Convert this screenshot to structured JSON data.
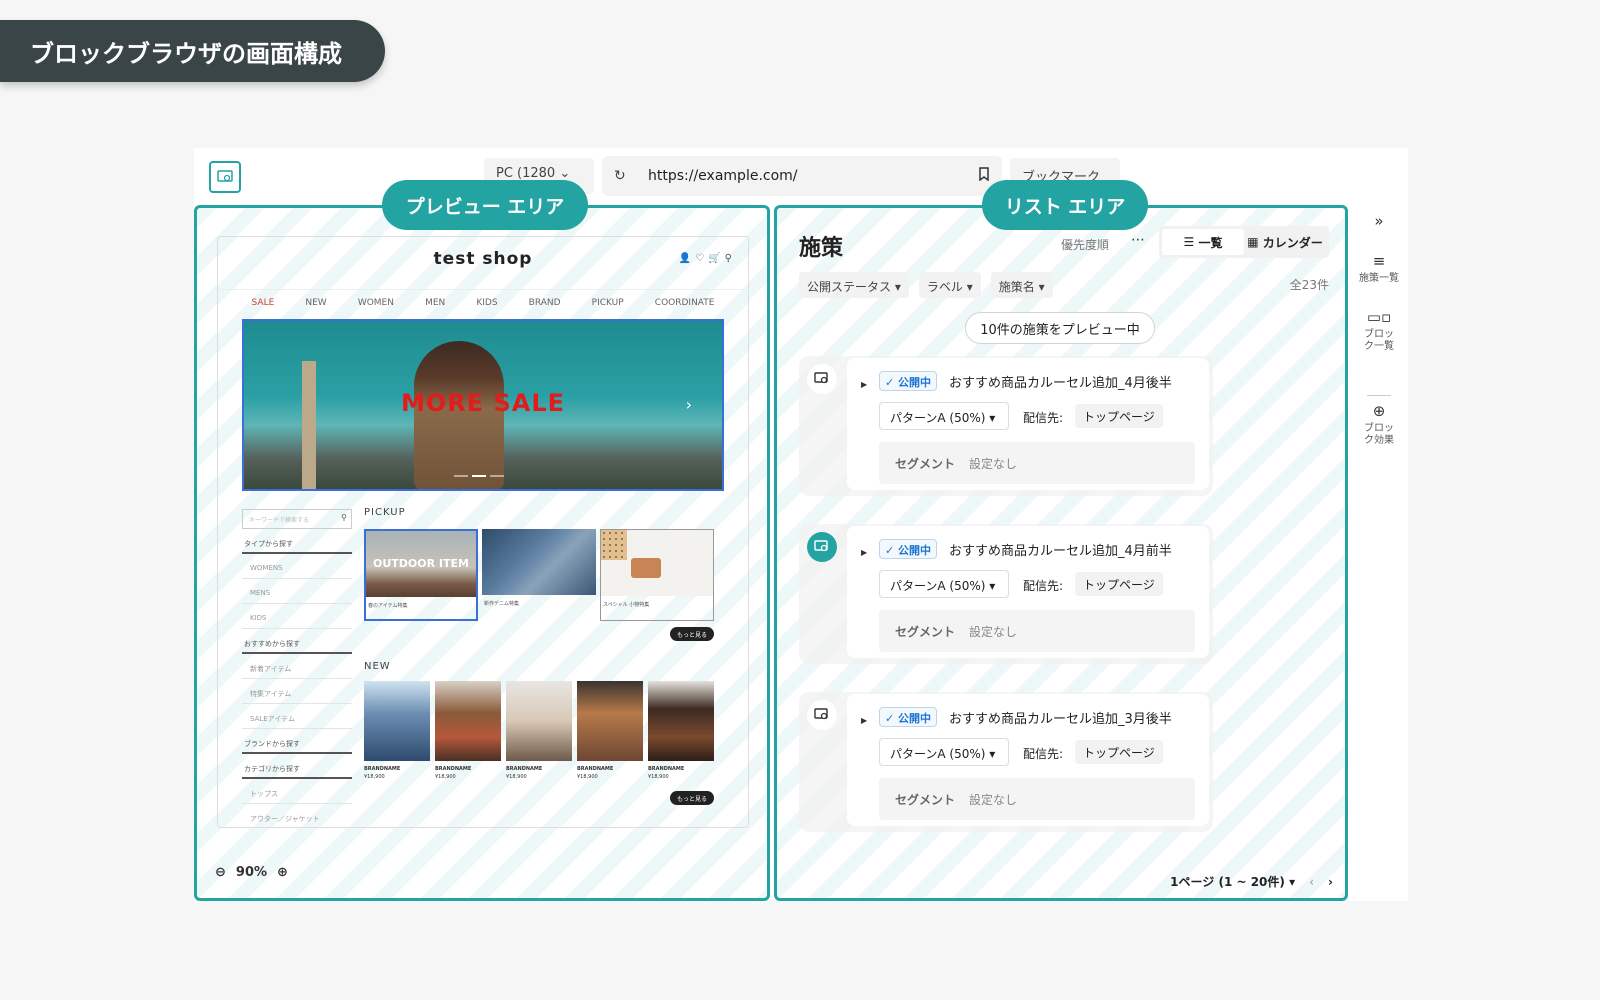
{
  "page_title": "ブロックブラウザの画面構成",
  "callouts": {
    "preview": "プレビュー エリア",
    "list": "リスト エリア"
  },
  "topbar": {
    "device_select": "PC (1280",
    "url": "https://example.com/",
    "bookmark_select": "ブックマーク"
  },
  "shop": {
    "name": "test shop",
    "nav": [
      "SALE",
      "NEW",
      "WOMEN",
      "MEN",
      "KIDS",
      "BRAND",
      "PICKUP",
      "COORDINATE"
    ],
    "hero_text": "MORE SALE",
    "search_placeholder": "キーワードで検索する",
    "side_menu": [
      {
        "label": "タイプから探す",
        "type": "head"
      },
      {
        "label": "WOMENS",
        "type": "sub"
      },
      {
        "label": "MENS",
        "type": "sub"
      },
      {
        "label": "KIDS",
        "type": "sub"
      },
      {
        "label": "おすすめから探す",
        "type": "head"
      },
      {
        "label": "新着アイテム",
        "type": "sub"
      },
      {
        "label": "特集アイテム",
        "type": "sub"
      },
      {
        "label": "SALEアイテム",
        "type": "sub"
      },
      {
        "label": "ブランドから探す",
        "type": "head"
      },
      {
        "label": "カテゴリから探す",
        "type": "head"
      },
      {
        "label": "トップス",
        "type": "sub"
      },
      {
        "label": "アウター／ジャケット",
        "type": "sub"
      }
    ],
    "pickup_label": "PICKUP",
    "pickup_items": [
      {
        "title": "OUTDOOR ITEM",
        "caption": "春のアイテム特集"
      },
      {
        "title": "",
        "caption": "新作デニム特集"
      },
      {
        "title": "",
        "caption": "スペシャル 小物特集"
      }
    ],
    "more_label": "もっと見る",
    "new_label": "NEW",
    "new_items": [
      {
        "brand": "BRANDNAME",
        "price": "¥18,900"
      },
      {
        "brand": "BRANDNAME",
        "price": "¥18,900"
      },
      {
        "brand": "BRANDNAME",
        "price": "¥18,900"
      },
      {
        "brand": "BRANDNAME",
        "price": "¥18,900"
      },
      {
        "brand": "BRANDNAME",
        "price": "¥18,900"
      }
    ]
  },
  "zoom": "90%",
  "list": {
    "title": "施策",
    "sort": "優先度順",
    "view_list": "一覧",
    "view_calendar": "カレンダー",
    "filters": [
      "公開ステータス",
      "ラベル",
      "施策名"
    ],
    "count": "全23件",
    "preview_button": "10件の施策をプレビュー中",
    "items": [
      {
        "status": "公開中",
        "name": "おすすめ商品カルーセル追加_4月後半",
        "pattern": "パターンA (50%)",
        "target_label": "配信先:",
        "target": "トップページ",
        "segment_label": "セグメント",
        "segment": "設定なし",
        "preview_on": false
      },
      {
        "status": "公開中",
        "name": "おすすめ商品カルーセル追加_4月前半",
        "pattern": "パターンA (50%)",
        "target_label": "配信先:",
        "target": "トップページ",
        "segment_label": "セグメント",
        "segment": "設定なし",
        "preview_on": true
      },
      {
        "status": "公開中",
        "name": "おすすめ商品カルーセル追加_3月後半",
        "pattern": "パターンA (50%)",
        "target_label": "配信先:",
        "target": "トップページ",
        "segment_label": "セグメント",
        "segment": "設定なし",
        "preview_on": false
      }
    ],
    "pager": "1ページ (1 ~ 20件)"
  },
  "sidebar": {
    "items": [
      "施策一覧",
      "ブロック一覧",
      "ブロック効果"
    ]
  },
  "colors": {
    "accent": "#24a3a3",
    "selection": "#3a6fd8",
    "sale_red": "#e11c1c"
  }
}
